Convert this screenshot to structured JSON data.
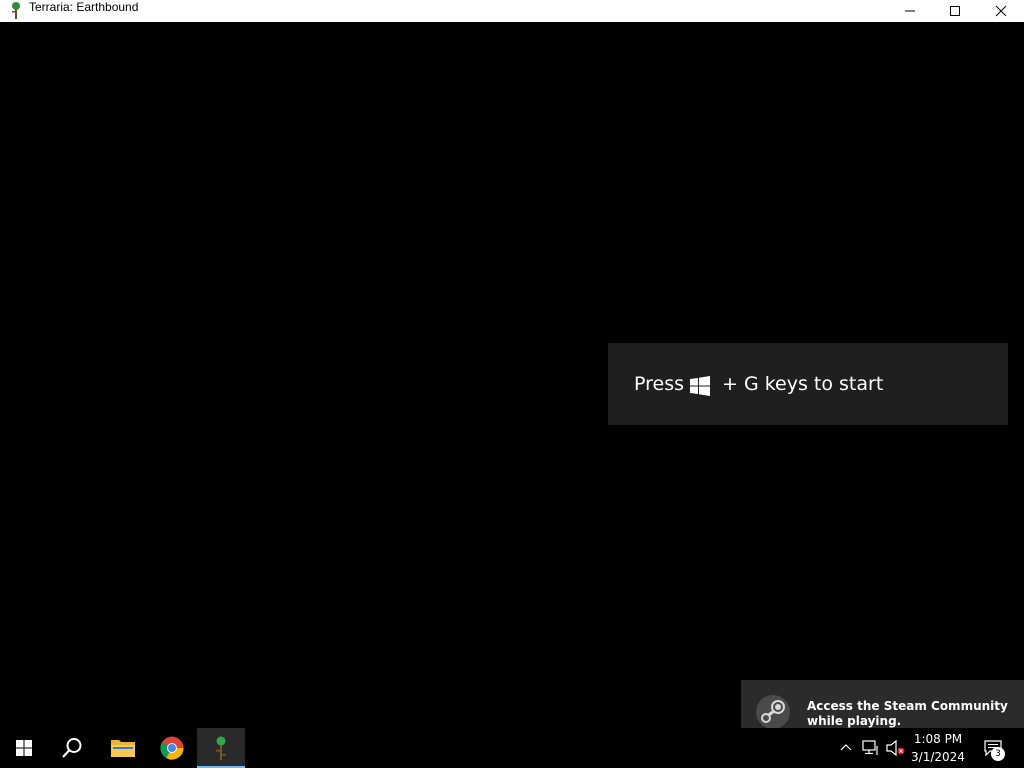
{
  "window": {
    "title": "Terraria: Earthbound",
    "icon": "terraria-tree-icon",
    "controls": [
      "minimize-icon",
      "maximize-icon",
      "close-icon"
    ]
  },
  "game_bar_toast": {
    "prefix": "Press",
    "suffix": "+ G keys to start",
    "key_icon": "windows-logo-icon"
  },
  "steam_notification": {
    "icon": "steam-icon",
    "text": "Access the Steam Community while playing."
  },
  "taskbar": {
    "apps": [
      {
        "name": "start",
        "icon": "windows-logo-icon"
      },
      {
        "name": "search",
        "icon": "search-icon"
      },
      {
        "name": "file-explorer",
        "icon": "folder-icon"
      },
      {
        "name": "chrome",
        "icon": "chrome-icon"
      },
      {
        "name": "terraria",
        "icon": "terraria-tree-icon",
        "active": true
      }
    ],
    "tray": {
      "icons": [
        "chevron-up-icon",
        "network-icon",
        "volume-muted-icon"
      ],
      "time": "1:08 PM",
      "date": "3/1/2024",
      "notification_count": "3"
    }
  },
  "colors": {
    "background": "#000000",
    "titlebar": "#ffffff",
    "toast": "#1f1f1f",
    "active_indicator": "#76b9ed"
  }
}
